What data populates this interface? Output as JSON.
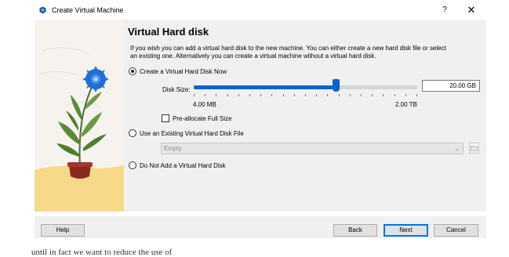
{
  "window": {
    "title": "Create Virtual Machine",
    "help_glyph": "?",
    "close_glyph": "✕"
  },
  "page": {
    "heading": "Virtual Hard disk",
    "description": "If you wish you can add a virtual hard disk to the new machine. You can either create a new hard disk file or select an existing one. Alternatively you can create a virtual machine without a virtual hard disk."
  },
  "options": {
    "create_now": {
      "label": "Create a Virtual Hard Disk Now",
      "checked": true
    },
    "use_existing": {
      "label": "Use an Existing Virtual Hard Disk File",
      "checked": false
    },
    "do_not_add": {
      "label": "Do Not Add a Virtual Hard Disk",
      "checked": false
    }
  },
  "disk_size": {
    "label": "Disk Size:",
    "value": "20.00 GB",
    "min_label": "4.00 MB",
    "max_label": "2.00 TB",
    "slider_fraction": 0.63
  },
  "preallocate": {
    "label": "Pre-allocate Full Size",
    "checked": false
  },
  "existing_file": {
    "selected": "Empty",
    "enabled": false
  },
  "buttons": {
    "help": "Help",
    "back": "Back",
    "next": "Next",
    "cancel": "Cancel"
  },
  "colors": {
    "accent": "#0a64c8",
    "dialog_bg": "#f0f0f0",
    "illustration_sand": "#f7d98a",
    "flower_blue": "#1f6fd6"
  },
  "background_text": "until in fact we want to reduce the use of"
}
